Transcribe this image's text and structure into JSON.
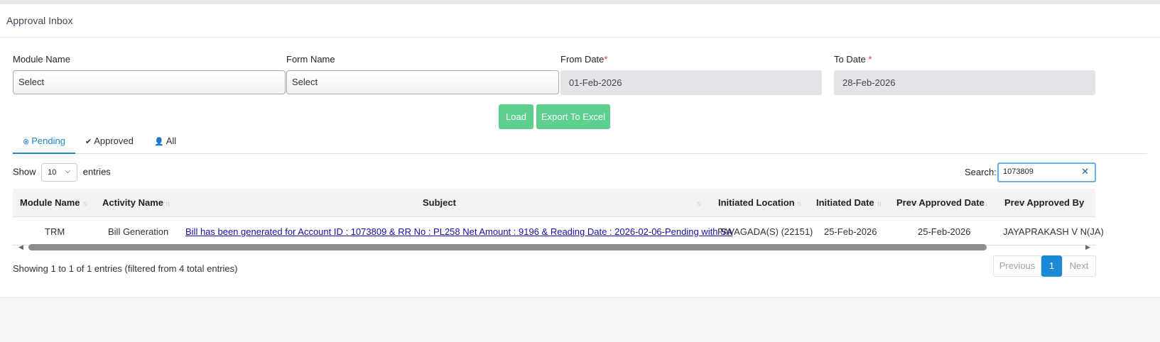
{
  "page": {
    "title": "Approval Inbox"
  },
  "filters": {
    "module_label": "Module Name",
    "module_value": "Select",
    "form_label": "Form Name",
    "form_value": "Select",
    "from_label": "From Date",
    "from_required": "*",
    "from_value": "01-Feb-2026",
    "to_label": "To Date ",
    "to_required": "*",
    "to_value": "28-Feb-2026"
  },
  "actions": {
    "load_label": "Load",
    "export_label": "Export To Excel"
  },
  "tabs": [
    {
      "label": "Pending",
      "icon": "times-circle-icon"
    },
    {
      "label": "Approved",
      "icon": "check-circle-icon"
    },
    {
      "label": "All",
      "icon": "user-icon"
    }
  ],
  "table_controls": {
    "show_label": "Show",
    "page_size": "10",
    "entries_label": "entries",
    "search_label": "Search:",
    "search_value": "1073809"
  },
  "table": {
    "columns": [
      "Module Name",
      "Activity Name",
      "Subject",
      "Initiated Location",
      "Initiated Date",
      "Prev Approved Date",
      "Prev Approved By"
    ],
    "rows": [
      {
        "module": "TRM",
        "activity": "Bill Generation",
        "subject": "Bill has been generated for Account ID : 1073809 & RR No : PL258 Net Amount : 9196 & Reading Date : 2026-02-06-Pending with SA",
        "location": "PAVAGADA(S) (22151)",
        "initiated_date": "25-Feb-2026",
        "prev_approved_date": "25-Feb-2026",
        "prev_approved_by": "JAYAPRAKASH V N(JA)"
      }
    ]
  },
  "footer": {
    "info": "Showing 1 to 1 of 1 entries (filtered from 4 total entries)",
    "previous_label": "Previous",
    "current_page": "1",
    "next_label": "Next"
  },
  "colors": {
    "accent": "#1f86c8",
    "button": "#5dd08f",
    "link": "#1a0dab",
    "required": "#e3342f"
  }
}
